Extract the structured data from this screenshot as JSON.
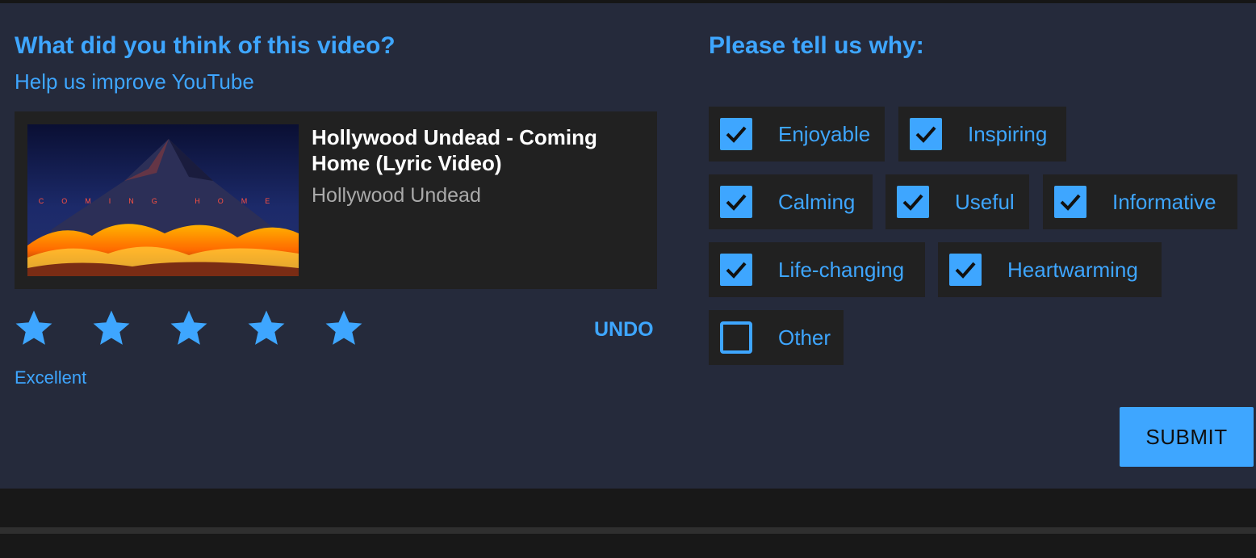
{
  "survey": {
    "question": "What did you think of this video?",
    "subtitle": "Help us improve YouTube",
    "video": {
      "title": "Hollywood Undead - Coming Home (Lyric Video)",
      "channel": "Hollywood Undead",
      "thumbnail_text": "COMING HOME"
    },
    "rating": {
      "stars_filled": 5,
      "stars_total": 5,
      "label": "Excellent",
      "undo_label": "UNDO",
      "star_icon": "star-icon",
      "star_color": "#3ea6ff"
    },
    "reasons": {
      "heading": "Please tell us why:",
      "options": [
        {
          "label": "Enjoyable",
          "checked": true
        },
        {
          "label": "Inspiring",
          "checked": true
        },
        {
          "label": "Calming",
          "checked": true
        },
        {
          "label": "Useful",
          "checked": true
        },
        {
          "label": "Informative",
          "checked": true
        },
        {
          "label": "Life-changing",
          "checked": true
        },
        {
          "label": "Heartwarming",
          "checked": true
        },
        {
          "label": "Other",
          "checked": false
        }
      ]
    },
    "submit_label": "SUBMIT"
  },
  "colors": {
    "accent": "#3ea6ff",
    "panel_bg": "#252a3b",
    "card_bg": "#212121",
    "text_primary": "#ffffff",
    "text_secondary": "#aaaaaa"
  }
}
